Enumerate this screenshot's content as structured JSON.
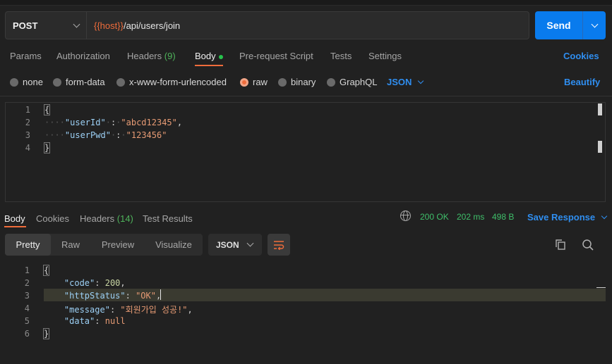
{
  "request": {
    "method": "POST",
    "url_var": "{{host}}",
    "url_path": "/api/users/join",
    "send_label": "Send"
  },
  "request_tabs": {
    "params": "Params",
    "authorization": "Authorization",
    "headers": "Headers",
    "headers_count": "(9)",
    "body": "Body",
    "pre_request": "Pre-request Script",
    "tests": "Tests",
    "settings": "Settings",
    "cookies": "Cookies"
  },
  "body_types": {
    "none": "none",
    "form_data": "form-data",
    "urlencoded": "x-www-form-urlencoded",
    "raw": "raw",
    "binary": "binary",
    "graphql": "GraphQL",
    "language": "JSON",
    "beautify": "Beautify"
  },
  "request_body": {
    "line_numbers": [
      "1",
      "2",
      "3",
      "4"
    ],
    "open_brace": "{",
    "close_brace": "}",
    "key1": "\"userId\"",
    "val1": "\"abcd12345\"",
    "key2": "\"userPwd\"",
    "val2": "\"123456\""
  },
  "response_tabs": {
    "body": "Body",
    "cookies": "Cookies",
    "headers": "Headers",
    "headers_count": "(14)",
    "test_results": "Test Results",
    "status": "200 OK",
    "time": "202 ms",
    "size": "498 B",
    "save": "Save Response"
  },
  "response_view": {
    "pretty": "Pretty",
    "raw": "Raw",
    "preview": "Preview",
    "visualize": "Visualize",
    "format": "JSON"
  },
  "response_body": {
    "line_numbers": [
      "1",
      "2",
      "3",
      "4",
      "5",
      "6"
    ],
    "open_brace": "{",
    "close_brace": "}",
    "k_code": "\"code\"",
    "v_code": "200",
    "k_status": "\"httpStatus\"",
    "v_status": "\"OK\"",
    "k_message": "\"message\"",
    "v_message": "\"회원가입 성공!\"",
    "k_data": "\"data\"",
    "v_data": "null"
  },
  "colors": {
    "accent": "#ef6c3b",
    "send_button": "#097bed",
    "link": "#2f8ef0",
    "status_ok": "#3fbf6a"
  },
  "icons": [
    "chevron-down-icon",
    "globe-icon",
    "wrap-lines-icon",
    "copy-icon",
    "search-icon"
  ]
}
